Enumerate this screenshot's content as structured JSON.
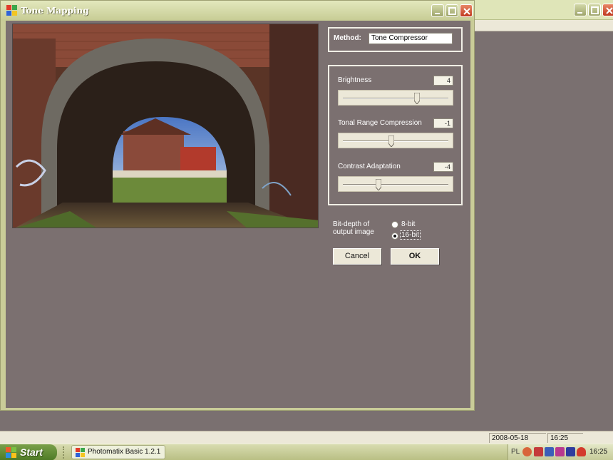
{
  "dialog": {
    "title": "Tone Mapping",
    "method": {
      "label": "Method:",
      "value": "Tone Compressor"
    },
    "sliders": [
      {
        "label": "Brightness",
        "value": "4",
        "position": 0.7
      },
      {
        "label": "Tonal Range Compression",
        "value": "-1",
        "position": 0.46
      },
      {
        "label": "Contrast Adaptation",
        "value": "-4",
        "position": 0.34
      }
    ],
    "bit_depth": {
      "label_line1": "Bit-depth of",
      "label_line2": "output image",
      "options": [
        "8-bit",
        "16-bit"
      ],
      "selected": "16-bit"
    },
    "buttons": {
      "cancel": "Cancel",
      "ok": "OK"
    }
  },
  "statusbar": {
    "date": "2008-05-18",
    "time": "16:25"
  },
  "taskbar": {
    "start_label": "Start",
    "task": "Photomatix Basic 1.2.1",
    "tray_lang": "PL",
    "clock": "16:25"
  },
  "colors": {
    "dialog_bg": "#7b7070",
    "titlebar": "#c9cc98",
    "close_button": "#c0391f",
    "start_button": "#4d7a25"
  }
}
